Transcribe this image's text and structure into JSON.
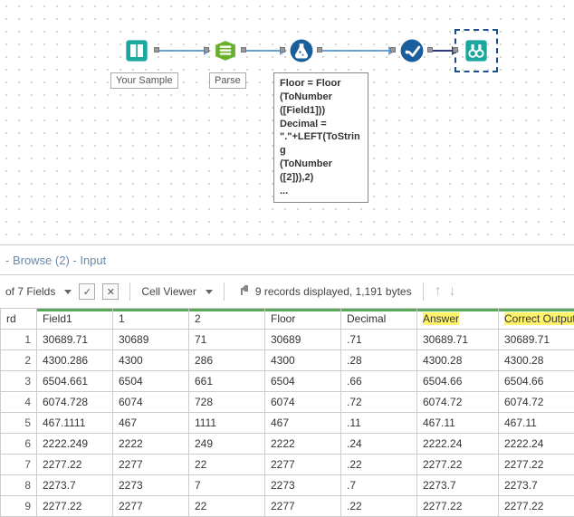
{
  "canvas": {
    "tool1_label": "Your Sample",
    "tool2_label": "Parse",
    "formula_text": "Floor = Floor\n(ToNumber\n([Field1]))\nDecimal = \".\"+LEFT(ToString\n(ToNumber\n([2])),2)\n..."
  },
  "results": {
    "panel_title": "- Browse (2) - Input",
    "fields_count_label": "of 7 Fields",
    "cell_viewer_label": "Cell Viewer",
    "records_text": "9 records displayed, 1,191 bytes",
    "headers": {
      "rownum": "rd",
      "field1": "Field1",
      "c1": "1",
      "c2": "2",
      "floor": "Floor",
      "decimal": "Decimal",
      "answer": "Answer",
      "correct": "Correct Output"
    },
    "rows": [
      {
        "n": "1",
        "field1": "30689.71",
        "c1": "30689",
        "c2": "71",
        "floor": "30689",
        "decimal": ".71",
        "answer": "30689.71",
        "correct": "30689.71"
      },
      {
        "n": "2",
        "field1": "4300.286",
        "c1": "4300",
        "c2": "286",
        "floor": "4300",
        "decimal": ".28",
        "answer": "4300.28",
        "correct": "4300.28"
      },
      {
        "n": "3",
        "field1": "6504.661",
        "c1": "6504",
        "c2": "661",
        "floor": "6504",
        "decimal": ".66",
        "answer": "6504.66",
        "correct": "6504.66"
      },
      {
        "n": "4",
        "field1": "6074.728",
        "c1": "6074",
        "c2": "728",
        "floor": "6074",
        "decimal": ".72",
        "answer": "6074.72",
        "correct": "6074.72"
      },
      {
        "n": "5",
        "field1": "467.1111",
        "c1": "467",
        "c2": "1111",
        "floor": "467",
        "decimal": ".11",
        "answer": "467.11",
        "correct": "467.11"
      },
      {
        "n": "6",
        "field1": "2222.249",
        "c1": "2222",
        "c2": "249",
        "floor": "2222",
        "decimal": ".24",
        "answer": "2222.24",
        "correct": "2222.24"
      },
      {
        "n": "7",
        "field1": "2277.22",
        "c1": "2277",
        "c2": "22",
        "floor": "2277",
        "decimal": ".22",
        "answer": "2277.22",
        "correct": "2277.22"
      },
      {
        "n": "8",
        "field1": "2273.7",
        "c1": "2273",
        "c2": "7",
        "floor": "2273",
        "decimal": ".7",
        "answer": "2273.7",
        "correct": "2273.7"
      },
      {
        "n": "9",
        "field1": "2277.22",
        "c1": "2277",
        "c2": "22",
        "floor": "2277",
        "decimal": ".22",
        "answer": "2277.22",
        "correct": "2277.22"
      }
    ]
  }
}
